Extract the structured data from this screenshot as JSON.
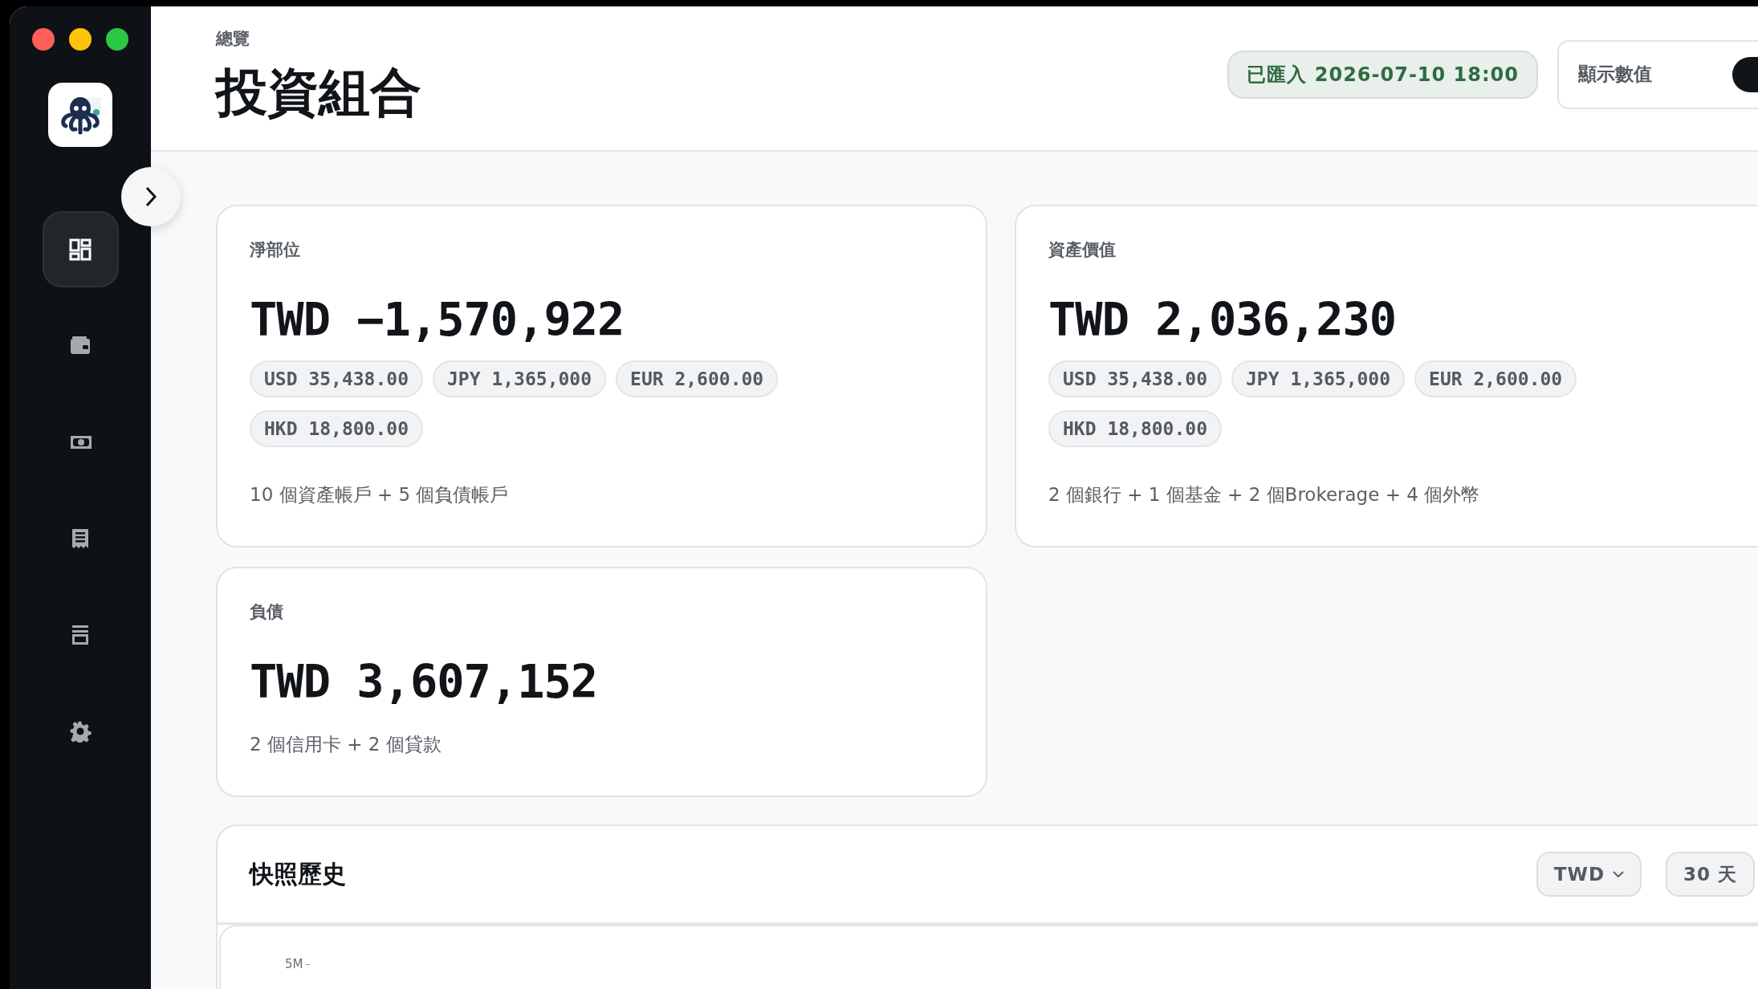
{
  "sidebar": {
    "items": [
      {
        "selected": true
      },
      {
        "selected": false
      },
      {
        "selected": false
      },
      {
        "selected": false
      },
      {
        "selected": false
      },
      {
        "selected": false
      }
    ]
  },
  "header": {
    "breadcrumb": "總覽",
    "title": "投資組合",
    "import_badge": "已匯入 2026-07-10 18:00",
    "toggle": {
      "label": "顯示數值",
      "on": true
    }
  },
  "cards": [
    {
      "label": "淨部位",
      "amount": "TWD −1,570,922",
      "chips": [
        "USD 35,438.00",
        "JPY 1,365,000",
        "EUR 2,600.00",
        "HKD 18,800.00"
      ],
      "summary": "10 個資產帳戶 + 5 個負債帳戶"
    },
    {
      "label": "資產價值",
      "amount": "TWD 2,036,230",
      "chips": [
        "USD 35,438.00",
        "JPY 1,365,000",
        "EUR 2,600.00",
        "HKD 18,800.00"
      ],
      "summary": "2 個銀行 + 1 個基金 + 2 個Brokerage + 4 個外幣"
    },
    {
      "label": "負債",
      "amount": "TWD 3,607,152",
      "summary": "2 個信用卡 + 2 個貸款"
    }
  ],
  "history": {
    "title": "快照歷史",
    "currency": "TWD",
    "range": "30 天",
    "y_tick": "5M"
  }
}
